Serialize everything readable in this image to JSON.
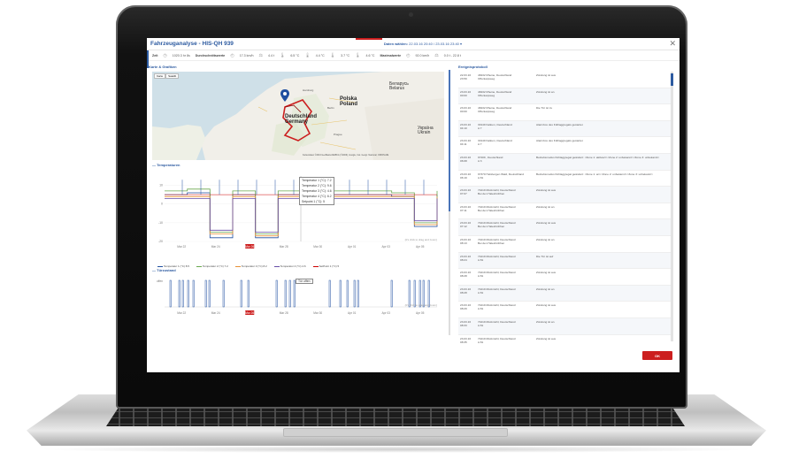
{
  "app": {
    "title": "Fahrzeuganalyse - HIS-QH 939",
    "date_label": "Daten wählen:",
    "date_range": "22.03.16 20:40 / 23.03.16 23:40 ▾",
    "close": "✕"
  },
  "stats": {
    "zeit_label": "Zeit",
    "zeit_value": "1020.3 hr 8s",
    "durchschnitt_label": "Durchschnittswerte",
    "avg_speed": "17.3 km/h",
    "avg_axle": "4.4 t",
    "avg_t1": "6.5 °C",
    "avg_t2": "4.4 °C",
    "avg_t3": "3.7 °C",
    "avg_t4": "4.6 °C",
    "max_label": "Maximalwerte",
    "max_speed": "92.0 km/h",
    "max_axle": "0.0 t - 22.8 t"
  },
  "map_section": {
    "title": "Karte & Grafiken",
    "tab_map": "Karte",
    "tab_sat": "Satellit",
    "labels": {
      "poland": "Polska\nPoland",
      "germany": "Deutschland\nGermany",
      "ukraine": "Україна\nUkrain",
      "belarus": "Беларусь\nBelarus",
      "city1": "Hamburg",
      "city2": "Berlin",
      "city3": "Prague",
      "attribution": "Kartendaten ©2016 GeoBasis-DE/BKG (©2009), Google, Inst. Geogr. Nacional, ORION-ME"
    }
  },
  "temp_chart": {
    "title": "Temperaturen",
    "footnote": "(it's click to drag and zoom)",
    "tooltips": [
      "Temperatur 1 (°C): 7.2",
      "Temperatur 2 (°C): 9.6",
      "Temperatur 3 (°C): 4.6",
      "Temperatur 4 (°C): 6.2",
      "Setpoint 1 (°C): 5"
    ],
    "legend": [
      {
        "name": "Temperatur 1 (°C)",
        "value": "8.5",
        "color": "#1f4fa0"
      },
      {
        "name": "Temperatur 2 (°C)",
        "value": "7.2",
        "color": "#6aa84f"
      },
      {
        "name": "Temperatur 3 (°C)",
        "value": "8.2",
        "color": "#e69138"
      },
      {
        "name": "Temperatur 4 (°C)",
        "value": "4.6",
        "color": "#674ea7"
      },
      {
        "name": "SetPoint 1 (°C)",
        "value": "5",
        "color": "#cc0000"
      }
    ]
  },
  "door_chart": {
    "title": "Türzustand",
    "tooltip": "Tür offen",
    "y_label": "offen",
    "footnote": "(it's click to drag and zoom)"
  },
  "chart_data": [
    {
      "type": "line",
      "title": "Temperaturen",
      "categories": [
        "Mar 22",
        "Mar 24",
        "Mar 26",
        "Mar 28",
        "Mar 30",
        "Apr 01",
        "Apr 03",
        "Apr 05"
      ],
      "ylim": [
        -20,
        15
      ],
      "yticks": [
        "10",
        "0",
        "-10",
        "-20"
      ],
      "series": [
        {
          "name": "Temperatur 1 (°C)",
          "color": "#1f4fa0",
          "values": [
            5,
            6,
            -18,
            5,
            -18,
            5,
            4,
            5,
            5,
            5,
            4,
            -12,
            5
          ]
        },
        {
          "name": "Temperatur 2 (°C)",
          "color": "#6aa84f",
          "values": [
            7,
            8,
            -15,
            7,
            -16,
            7,
            6,
            7,
            7,
            7,
            6,
            -10,
            7
          ]
        },
        {
          "name": "Temperatur 3 (°C)",
          "color": "#e69138",
          "values": [
            4,
            4,
            -16,
            4,
            -17,
            4,
            4,
            4,
            4,
            4,
            4,
            -11,
            4
          ]
        },
        {
          "name": "Temperatur 4 (°C)",
          "color": "#674ea7",
          "values": [
            3,
            3,
            -14,
            3,
            -15,
            3,
            3,
            3,
            3,
            3,
            3,
            -9,
            3
          ]
        },
        {
          "name": "SetPoint 1 (°C)",
          "color": "#cc0000",
          "values": [
            5,
            5,
            5,
            5,
            5,
            5,
            5,
            5,
            5,
            5,
            5,
            5,
            5
          ]
        }
      ],
      "highlight": "Mar 26"
    },
    {
      "type": "bar",
      "title": "Türzustand",
      "categories": [
        "Mar 22",
        "Mar 24",
        "Mar 26",
        "Mar 28",
        "Mar 30",
        "Apr 01",
        "Apr 03",
        "Apr 05"
      ],
      "highlight": "Mar 26"
    }
  ],
  "events": {
    "title": "Ereignisprotokoll",
    "rows": [
      {
        "time": "22.03.16\n23:59",
        "loc": "48432 Rheine, Deutschland\nOffenlanpweg",
        "msg": "Zündung ist aus"
      },
      {
        "time": "23.03.16\n00:00",
        "loc": "48432 Rheine, Deutschland\nOffenlanpweg",
        "msg": "Zündung ist an"
      },
      {
        "time": "23.03.16\n00:00",
        "loc": "48432 Rheine, Deutschland\nOffenlanpweg",
        "msg": "Die Tür ist zu"
      },
      {
        "time": "23.03.16\n04:10",
        "loc": "30149 Kalkum, Deutschland\nA 7",
        "msg": "Alarmbox des Kühlaggregats gestartet"
      },
      {
        "time": "23.03.16\n04:11",
        "loc": "30149 Kalkum, Deutschland\nA 7",
        "msg": "Alarmbox des Kühlaggregats gestartet"
      },
      {
        "time": "23.03.16\n06:08",
        "loc": "97209 , Deutschland\nA 3",
        "msg": "Betriebsmodus Kühlaggregat geändert: <Zone 1: aktiviert><Zone 2: unbekannt><Zone 3: unbekannt>"
      },
      {
        "time": "23.03.16\n06:19",
        "loc": "97370 Helsbergen Wald, Deutschland\nA 81",
        "msg": "Betriebsmodus Kühlaggregat geändert: <Zone 1: an><Zone 2: unbekannt><Zone 3: unbekannt>"
      },
      {
        "time": "23.03.16\n07:07",
        "loc": "74219 Möckmühl, Deutschland\nBei den Haleshöfchen",
        "msg": "Zündung ist aus"
      },
      {
        "time": "23.03.16\n07:11",
        "loc": "74219 Möckmühl, Deutschland\nBei den Haleshöfchen",
        "msg": "Zündung ist an"
      },
      {
        "time": "23.03.16\n07:12",
        "loc": "74219 Möckmühl, Deutschland\nBei den Haleshöfchen",
        "msg": "Zündung ist aus"
      },
      {
        "time": "23.03.16\n08:13",
        "loc": "74219 Möckmühl, Deutschland\nBei den Haleshöfchen",
        "msg": "Zündung ist an"
      },
      {
        "time": "23.03.16\n08:24",
        "loc": "74219 Möckmühl, Deutschland\nA 81",
        "msg": "Die Tür ist auf"
      },
      {
        "time": "23.03.16\n08:28",
        "loc": "74219 Möckmühl, Deutschland\nA 81",
        "msg": "Zündung ist aus"
      },
      {
        "time": "23.03.16\n08:28",
        "loc": "74219 Möckmühl, Deutschland\nA 81",
        "msg": "Zündung ist an"
      },
      {
        "time": "23.03.16\n08:29",
        "loc": "74219 Möckmühl, Deutschland\nA 81",
        "msg": "Zündung ist aus"
      },
      {
        "time": "23.03.16\n08:33",
        "loc": "74219 Möckmühl, Deutschland\nA 81",
        "msg": "Zündung ist an"
      },
      {
        "time": "23.03.16\n08:35",
        "loc": "74219 Möckmühl, Deutschland\nA 81",
        "msg": "Zündung ist aus"
      }
    ]
  },
  "footer": {
    "ok_label": "OK"
  }
}
